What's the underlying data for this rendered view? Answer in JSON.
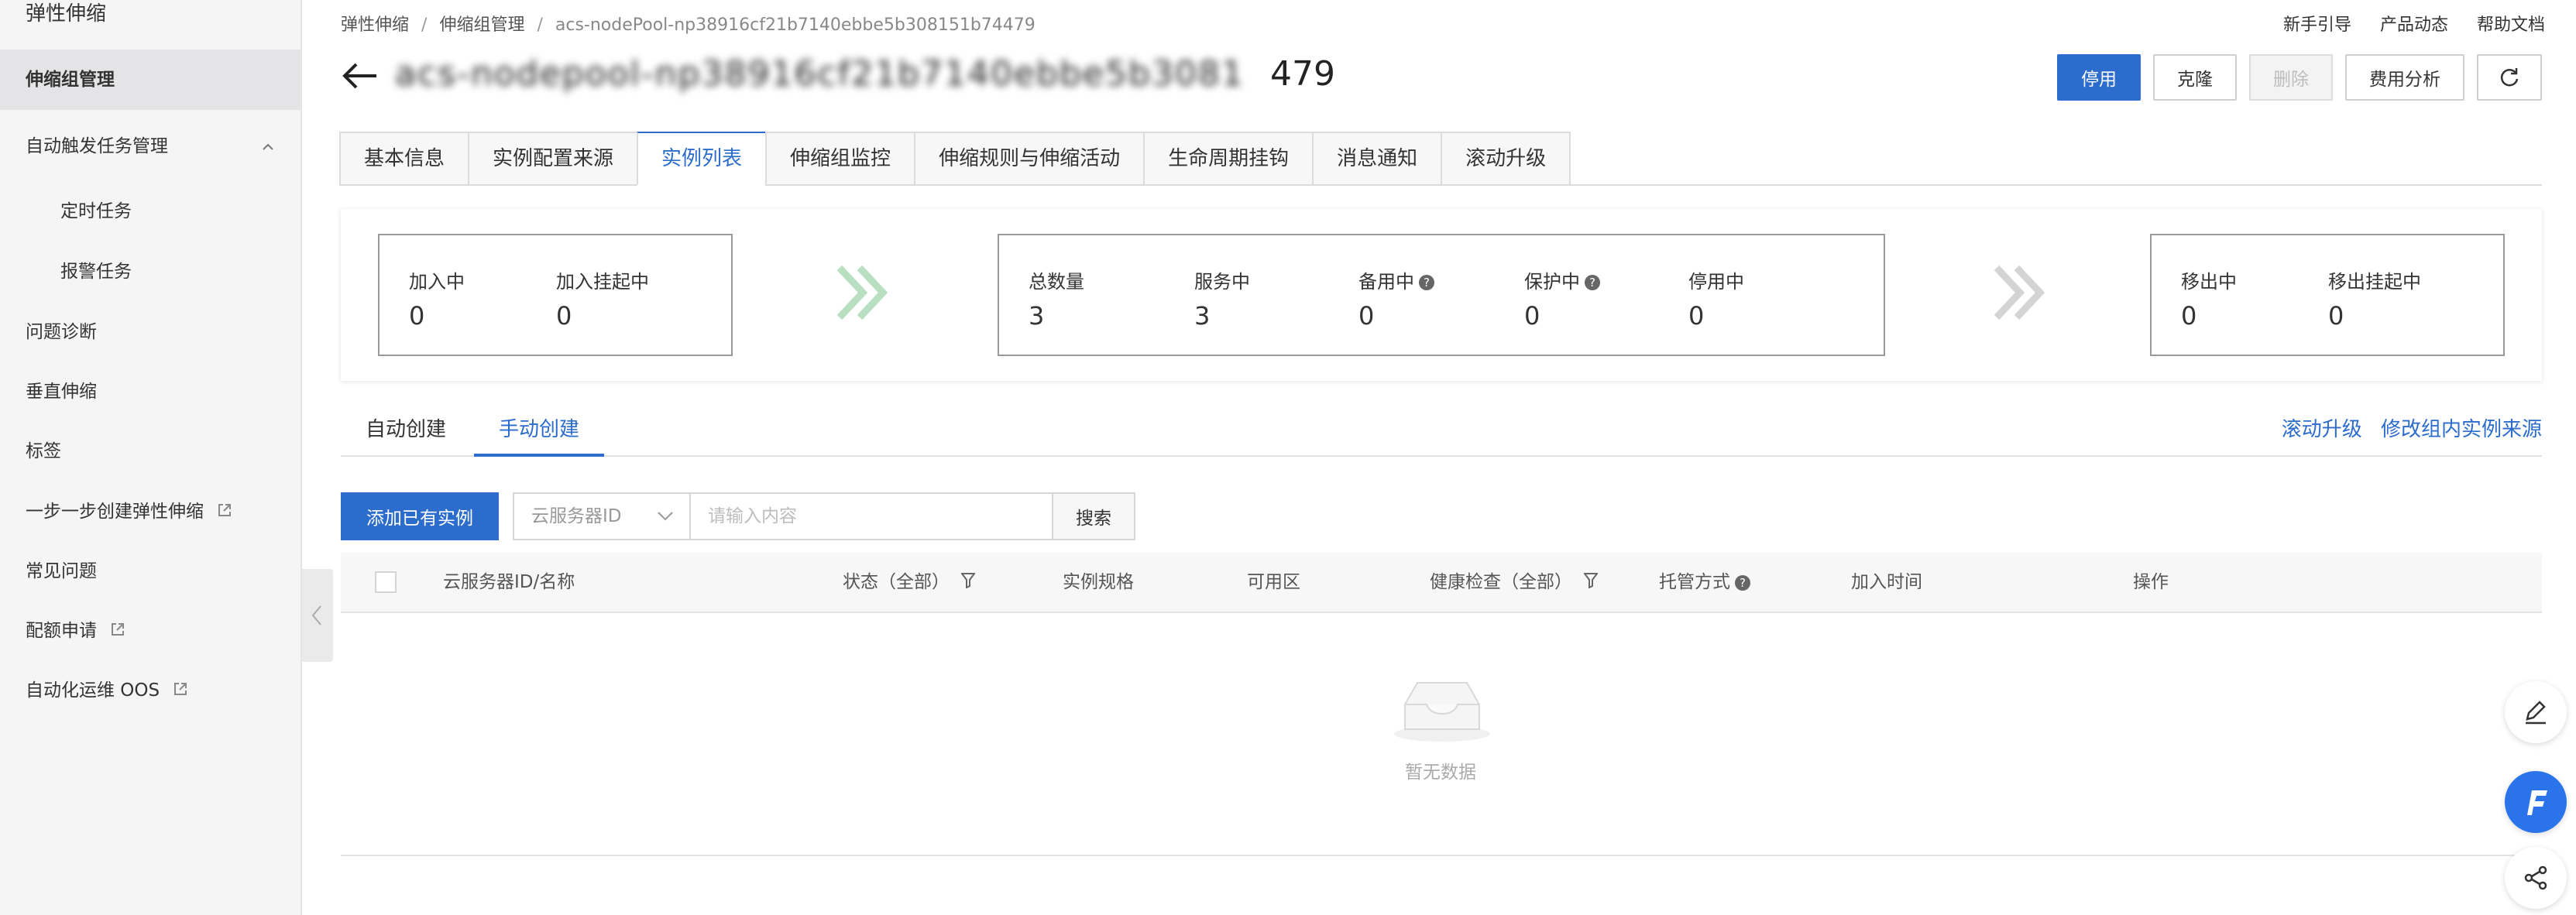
{
  "sidebar": {
    "title": "弹性伸缩",
    "items": [
      {
        "label": "伸缩组管理"
      },
      {
        "label": "自动触发任务管理"
      },
      {
        "label": "定时任务"
      },
      {
        "label": "报警任务"
      },
      {
        "label": "问题诊断"
      },
      {
        "label": "垂直伸缩"
      },
      {
        "label": "标签"
      },
      {
        "label": "一步一步创建弹性伸缩"
      },
      {
        "label": "常见问题"
      },
      {
        "label": "配额申请"
      },
      {
        "label": "自动化运维 OOS"
      }
    ]
  },
  "breadcrumb": {
    "items": [
      "弹性伸缩",
      "伸缩组管理",
      "acs-nodePool-np38916cf21b7140ebbe5b308151b74479"
    ],
    "separator": "/"
  },
  "top_links": [
    "新手引导",
    "产品动态",
    "帮助文档"
  ],
  "header": {
    "title_blurred": "acs-nodepool-np38916cf21b7140ebbe5b3081",
    "title_tail": "479"
  },
  "actions": {
    "disable": "停用",
    "clone": "克隆",
    "delete": "删除",
    "cost": "费用分析"
  },
  "tabs": [
    "基本信息",
    "实例配置来源",
    "实例列表",
    "伸缩组监控",
    "伸缩规则与伸缩活动",
    "生命周期挂钩",
    "消息通知",
    "滚动升级"
  ],
  "stats": {
    "joining": {
      "label": "加入中",
      "value": "0"
    },
    "joining_pending": {
      "label": "加入挂起中",
      "value": "0"
    },
    "total": {
      "label": "总数量",
      "value": "3"
    },
    "in_service": {
      "label": "服务中",
      "value": "3"
    },
    "standby": {
      "label": "备用中",
      "value": "0"
    },
    "protected": {
      "label": "保护中",
      "value": "0"
    },
    "stopped": {
      "label": "停用中",
      "value": "0"
    },
    "removing": {
      "label": "移出中",
      "value": "0"
    },
    "removing_pending": {
      "label": "移出挂起中",
      "value": "0"
    }
  },
  "subtabs": {
    "auto": "自动创建",
    "manual": "手动创建",
    "rolling_upgrade": "滚动升级",
    "modify_source": "修改组内实例来源"
  },
  "toolbar": {
    "add_existing": "添加已有实例",
    "select_value": "云服务器ID",
    "search_placeholder": "请输入内容",
    "search_button": "搜索"
  },
  "table": {
    "columns": [
      "云服务器ID/名称",
      "状态（全部）",
      "实例规格",
      "可用区",
      "健康检查（全部）",
      "托管方式",
      "加入时间",
      "操作"
    ],
    "empty_text": "暂无数据"
  },
  "colors": {
    "primary": "#2b6ccc",
    "sidebar_bg": "#f5f5f6",
    "arrow_green": "#b7dfc0",
    "arrow_gray": "#d4d4d4"
  }
}
